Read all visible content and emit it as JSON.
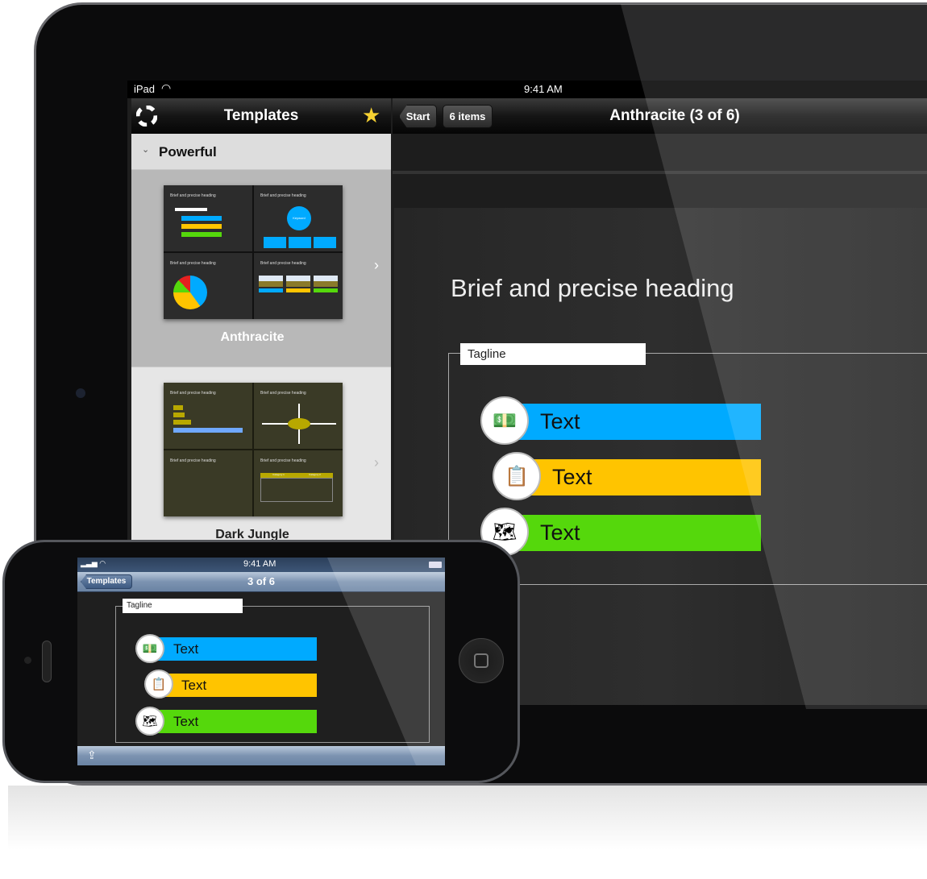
{
  "ipad": {
    "status": {
      "carrier": "iPad",
      "time": "9:41 AM"
    },
    "sidebar": {
      "title": "Templates",
      "section": "Powerful",
      "templates": [
        {
          "name": "Anthracite",
          "selected": true,
          "cells": [
            "Brief and precise heading",
            "Brief and precise heading",
            "Brief and precise heading",
            "Brief and precise heading"
          ],
          "keyword": "Keyword",
          "item": "Text"
        },
        {
          "name": "Dark Jungle",
          "selected": false,
          "cells": [
            "Brief and precise heading",
            "Brief and precise heading",
            "Brief and precise heading",
            "Brief and precise heading"
          ],
          "tagline": "Tagline",
          "cat1": "Category 1",
          "cat2": "Category 2",
          "item": "Text"
        }
      ]
    },
    "detail": {
      "back_button": "Start",
      "items_button": "6 items",
      "title": "Anthracite (3 of 6)",
      "slide": {
        "heading": "Brief and precise heading",
        "tagline": "Tagline",
        "items": [
          {
            "label": "Text",
            "color": "#00aaff",
            "icon": "money-icon"
          },
          {
            "label": "Text",
            "color": "#ffc400",
            "icon": "clipboard-checklist-icon"
          },
          {
            "label": "Text",
            "color": "#55d80c",
            "icon": "world-map-tickets-icon"
          }
        ]
      }
    }
  },
  "iphone": {
    "status": {
      "time": "9:41 AM"
    },
    "nav": {
      "back_button": "Templates",
      "title": "3 of 6"
    },
    "slide": {
      "tagline": "Tagline",
      "items": [
        {
          "label": "Text",
          "color": "#00aaff"
        },
        {
          "label": "Text",
          "color": "#ffc400"
        },
        {
          "label": "Text",
          "color": "#55d80c"
        }
      ]
    }
  }
}
